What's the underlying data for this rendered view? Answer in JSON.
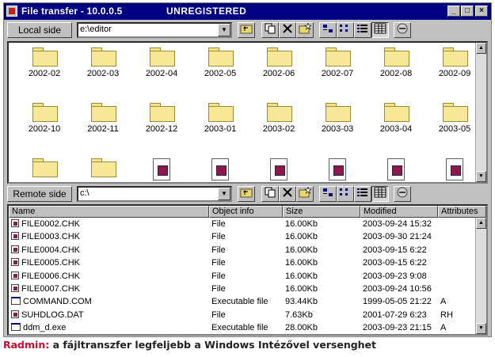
{
  "window": {
    "title": "File transfer - 10.0.0.5",
    "status": "UNREGISTERED",
    "controls": {
      "minimize": "_",
      "maximize": "□",
      "close": "×"
    }
  },
  "local": {
    "side_label": "Local side",
    "path": "e:\\editor",
    "items": [
      {
        "type": "folder",
        "name": "2002-02"
      },
      {
        "type": "folder",
        "name": "2002-03"
      },
      {
        "type": "folder",
        "name": "2002-04"
      },
      {
        "type": "folder",
        "name": "2002-05"
      },
      {
        "type": "folder",
        "name": "2002-06"
      },
      {
        "type": "folder",
        "name": "2002-07"
      },
      {
        "type": "folder",
        "name": "2002-08"
      },
      {
        "type": "folder",
        "name": "2002-09"
      },
      {
        "type": "folder",
        "name": "2002-10"
      },
      {
        "type": "folder",
        "name": "2002-11"
      },
      {
        "type": "folder",
        "name": "2002-12"
      },
      {
        "type": "folder",
        "name": "2003-01"
      },
      {
        "type": "folder",
        "name": "2003-02"
      },
      {
        "type": "folder",
        "name": "2003-03"
      },
      {
        "type": "folder",
        "name": "2003-04"
      },
      {
        "type": "folder",
        "name": "2003-05"
      },
      {
        "type": "folder",
        "name": ""
      },
      {
        "type": "folder",
        "name": ""
      },
      {
        "type": "file",
        "name": ""
      },
      {
        "type": "file",
        "name": ""
      },
      {
        "type": "file",
        "name": ""
      },
      {
        "type": "file",
        "name": ""
      },
      {
        "type": "file",
        "name": ""
      },
      {
        "type": "file",
        "name": ""
      }
    ]
  },
  "remote": {
    "side_label": "Remote side",
    "path": "c:\\",
    "columns": [
      "Name",
      "Object info",
      "Size",
      "Modified",
      "Attributes"
    ],
    "rows": [
      {
        "icon": "chk-file-icon",
        "name": "FILE0002.CHK",
        "info": "File",
        "size": "16.00Kb",
        "modified": "2003-09-24 15:32",
        "attr": ""
      },
      {
        "icon": "chk-file-icon",
        "name": "FILE0003.CHK",
        "info": "File",
        "size": "16.00Kb",
        "modified": "2003-09-30 21:24",
        "attr": ""
      },
      {
        "icon": "chk-file-icon",
        "name": "FILE0004.CHK",
        "info": "File",
        "size": "16.00Kb",
        "modified": "2003-09-15 6:22",
        "attr": ""
      },
      {
        "icon": "chk-file-icon",
        "name": "FILE0005.CHK",
        "info": "File",
        "size": "16.00Kb",
        "modified": "2003-09-15 6:22",
        "attr": ""
      },
      {
        "icon": "chk-file-icon",
        "name": "FILE0006.CHK",
        "info": "File",
        "size": "16.00Kb",
        "modified": "2003-09-23 9:08",
        "attr": ""
      },
      {
        "icon": "chk-file-icon",
        "name": "FILE0007.CHK",
        "info": "File",
        "size": "16.00Kb",
        "modified": "2003-09-24 10:56",
        "attr": ""
      },
      {
        "icon": "exe-file-icon",
        "name": "COMMAND.COM",
        "info": "Executable file",
        "size": "93.44Kb",
        "modified": "1999-05-05 21:22",
        "attr": "A"
      },
      {
        "icon": "chk-file-icon",
        "name": "SUHDLOG.DAT",
        "info": "File",
        "size": "7.63Kb",
        "modified": "2001-07-29 6:23",
        "attr": "RH"
      },
      {
        "icon": "exe-file-icon",
        "name": "ddm_d.exe",
        "info": "Executable file",
        "size": "28.00Kb",
        "modified": "2003-09-23 21:15",
        "attr": "A"
      }
    ]
  },
  "caption": {
    "brand": "Radmin:",
    "text": " a fájltranszfer legfeljebb a Windows Intézővel versenghet"
  },
  "icons": {
    "path_dropdown": "▼",
    "toolbar": [
      "up-folder-icon",
      "copy-icon",
      "delete-icon",
      "new-folder-icon",
      "large-icons-view-icon",
      "small-icons-view-icon",
      "list-view-icon",
      "details-view-icon",
      "stop-icon"
    ],
    "scroll_up": "▲",
    "scroll_down": "▼"
  },
  "colors": {
    "titlebar": "#000080",
    "caption_brand": "#c8102e"
  }
}
